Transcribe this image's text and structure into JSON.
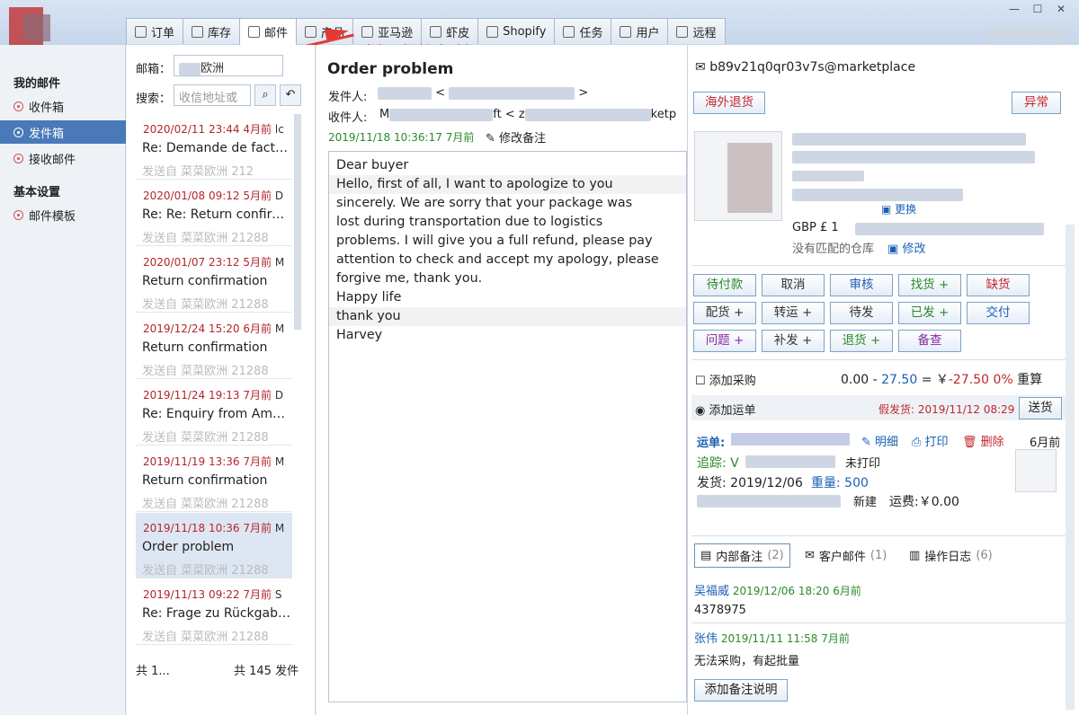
{
  "tabs": [
    {
      "label": "订单",
      "icon": "document-icon"
    },
    {
      "label": "库存",
      "icon": "box-icon"
    },
    {
      "label": "邮件",
      "icon": "mail-icon"
    },
    {
      "label": "产品",
      "icon": "grid-icon"
    },
    {
      "label": "亚马逊",
      "icon": "amazon-icon"
    },
    {
      "label": "虾皮",
      "icon": "shopee-icon"
    },
    {
      "label": "Shopify",
      "icon": "shopify-icon"
    },
    {
      "label": "任务",
      "icon": "task-icon"
    },
    {
      "label": "用户",
      "icon": "user-icon"
    },
    {
      "label": "远程",
      "icon": "monitor-icon"
    }
  ],
  "annotation": "选择发件邮箱",
  "sidebar": {
    "my_mail": "我的邮件",
    "inbox": "收件箱",
    "sent": "发件箱",
    "receive": "接收邮件",
    "settings": "基本设置",
    "templates": "邮件模板"
  },
  "list": {
    "mailbox_label": "邮箱：",
    "mailbox_value": "欧洲",
    "search_label": "搜索：",
    "search_placeholder": "收信地址或",
    "footer_left": "共 1...",
    "footer_right": "共 145 发件",
    "items": [
      {
        "date": "2020/02/11 23:44",
        "ago": "4月前",
        "tag": "lc",
        "subject": "Re: Demande de factu...",
        "from": "发送自  菜菜欧洲  212"
      },
      {
        "date": "2020/01/08 09:12",
        "ago": "5月前",
        "tag": "D",
        "subject": "Re: Re: Return confirm...",
        "from": "发送自  菜菜欧洲  21288"
      },
      {
        "date": "2020/01/07 23:12",
        "ago": "5月前",
        "tag": "M",
        "subject": "Return confirmation",
        "from": "发送自  菜菜欧洲  21288"
      },
      {
        "date": "2019/12/24 15:20",
        "ago": "6月前",
        "tag": "M",
        "subject": "Return confirmation",
        "from": "发送自  菜菜欧洲  21288"
      },
      {
        "date": "2019/11/24 19:13",
        "ago": "7月前",
        "tag": "D",
        "subject": "Re: Enquiry from Ama...",
        "from": "发送自  菜菜欧洲  21288"
      },
      {
        "date": "2019/11/19 13:36",
        "ago": "7月前",
        "tag": "M",
        "subject": "Return confirmation",
        "from": "发送自  菜菜欧洲  21288"
      },
      {
        "date": "2019/11/18 10:36",
        "ago": "7月前",
        "tag": "M",
        "subject": "Order problem",
        "from": "发送自  菜菜欧洲  21288"
      },
      {
        "date": "2019/11/13 09:22",
        "ago": "7月前",
        "tag": "S",
        "subject": "Re: Frage zu Rückgabe...",
        "from": "发送自  菜菜欧洲  21288"
      }
    ]
  },
  "reader": {
    "subject": "Order problem",
    "from_label": "发件人:",
    "to_label": "收件人:",
    "to_visible": "M",
    "to_mid": "ft < z",
    "to_end": "ketp",
    "date": "2019/11/18 10:36:17",
    "ago": "7月前",
    "edit_note": "修改备注",
    "body": [
      "Dear buyer",
      "Hello, first of all, I want to apologize to you",
      "sincerely. We are sorry that your package was",
      "lost during transportation due to logistics",
      "problems. I will give you a full refund, please pay",
      "attention to check and accept my apology, please",
      "forgive me, thank you.",
      "Happy life",
      "thank you",
      "Harvey"
    ]
  },
  "order": {
    "email": "b89v21q0qr03v7s@marketplace",
    "overseas_return": "海外退货",
    "abnormal": "异常",
    "replace": "更换",
    "currency": "GBP £ 1",
    "no_warehouse": "没有匹配的仓库",
    "modify": "修改",
    "actions": [
      {
        "label": "待付款",
        "color": "#2a8a2a"
      },
      {
        "label": "取消",
        "color": "#333"
      },
      {
        "label": "审核",
        "color": "#1a5fb4"
      },
      {
        "label": "找货 +",
        "color": "#2a8a2a"
      },
      {
        "label": "缺货",
        "color": "#c0272d"
      },
      {
        "label": "配货 +",
        "color": "#333"
      },
      {
        "label": "转运 +",
        "color": "#333"
      },
      {
        "label": "待发",
        "color": "#333"
      },
      {
        "label": "已发 +",
        "color": "#2a8a2a"
      },
      {
        "label": "交付",
        "color": "#1a5fb4"
      },
      {
        "label": "问题 +",
        "color": "#8a2aa0"
      },
      {
        "label": "补发 +",
        "color": "#333"
      },
      {
        "label": "退货 +",
        "color": "#2a8a2a"
      },
      {
        "label": "备查",
        "color": "#8a2aa0"
      }
    ],
    "add_purchase": "添加采购",
    "cost": "0.00",
    "dash": "-",
    "amount1": "27.50",
    "eq": "= ￥",
    "amount2": "-27.50",
    "pct": "0%",
    "weigh": "重算",
    "add_waybill": "添加运单",
    "fake_ship": "假发货: 2019/11/12 08:29",
    "ship_btn": "送货",
    "waybill_label": "运单:",
    "detail": "明细",
    "print": "打印",
    "delete": "删除",
    "waybill_ago": "6月前",
    "track_label": "追踪: V",
    "track_status": "未打印",
    "ship_date": "发货: 2019/12/06",
    "weight_label": "重量:",
    "weight": "500",
    "new": "新建",
    "freight": "运费:￥0.00",
    "tab_internal": "内部备注",
    "tab_internal_count": "(2)",
    "tab_customer": "客户邮件",
    "tab_customer_count": "(1)",
    "tab_log": "操作日志",
    "tab_log_count": "(6)",
    "notes": [
      {
        "author": "吴福威",
        "time": "2019/12/06 18:20",
        "ago": "6月前",
        "text": "4378975"
      },
      {
        "author": "张伟",
        "time": "2019/11/11 11:58",
        "ago": "7月前",
        "text": "无法采购，有起批量"
      }
    ],
    "add_note": "添加备注说明"
  }
}
